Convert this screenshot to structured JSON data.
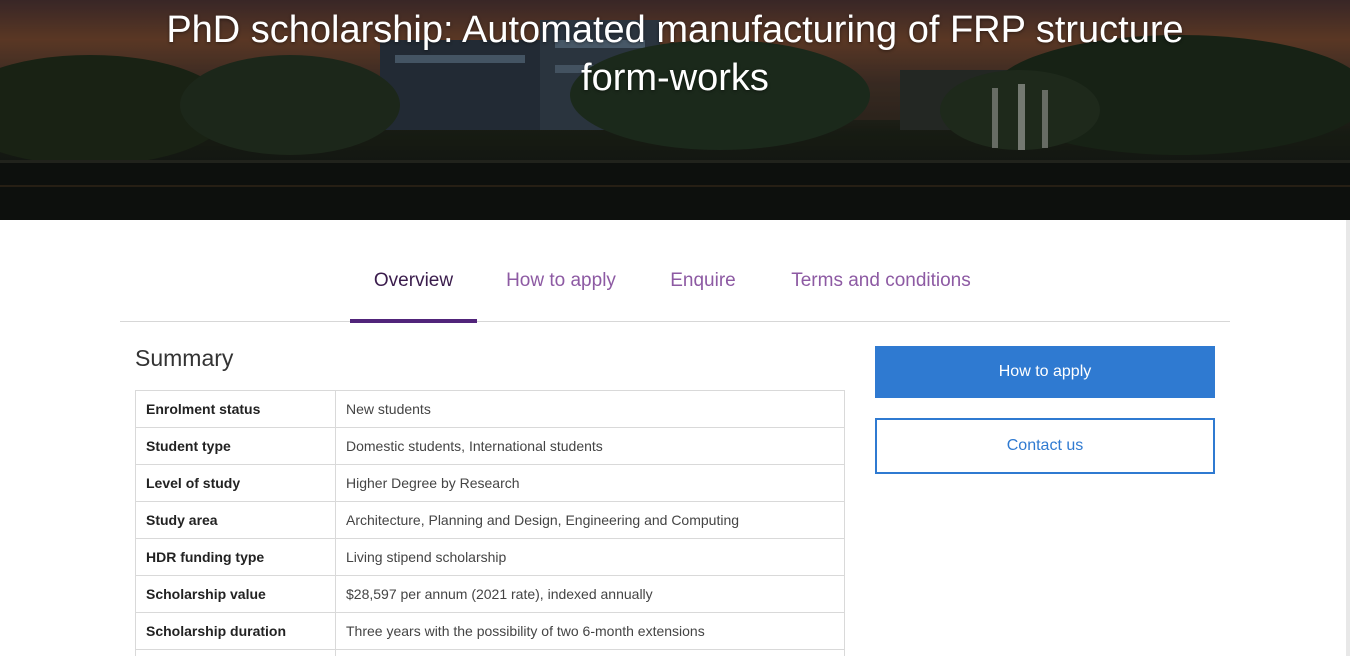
{
  "hero": {
    "title_line1": "PhD scholarship: Automated manufacturing of FRP structure",
    "title_line2": "form-works"
  },
  "tabs": [
    {
      "label": "Overview",
      "active": true
    },
    {
      "label": "How to apply",
      "active": false
    },
    {
      "label": "Enquire",
      "active": false
    },
    {
      "label": "Terms and conditions",
      "active": false
    }
  ],
  "summary": {
    "heading": "Summary",
    "rows": [
      {
        "key": "Enrolment status",
        "value": "New students"
      },
      {
        "key": "Student type",
        "value": "Domestic students, International students"
      },
      {
        "key": "Level of study",
        "value": "Higher Degree by Research"
      },
      {
        "key": "Study area",
        "value": "Architecture, Planning and Design, Engineering and Computing"
      },
      {
        "key": "HDR funding type",
        "value": "Living stipend scholarship"
      },
      {
        "key": "Scholarship value",
        "value": "$28,597 per annum (2021 rate), indexed annually"
      },
      {
        "key": "Scholarship duration",
        "value": "Three years with the possibility of two 6-month extensions"
      }
    ]
  },
  "actions": {
    "apply_label": "How to apply",
    "contact_label": "Contact us"
  },
  "colors": {
    "accent_blue": "#2f7ad1",
    "brand_purple": "#51247a",
    "tab_text": "#8d5aa3"
  }
}
